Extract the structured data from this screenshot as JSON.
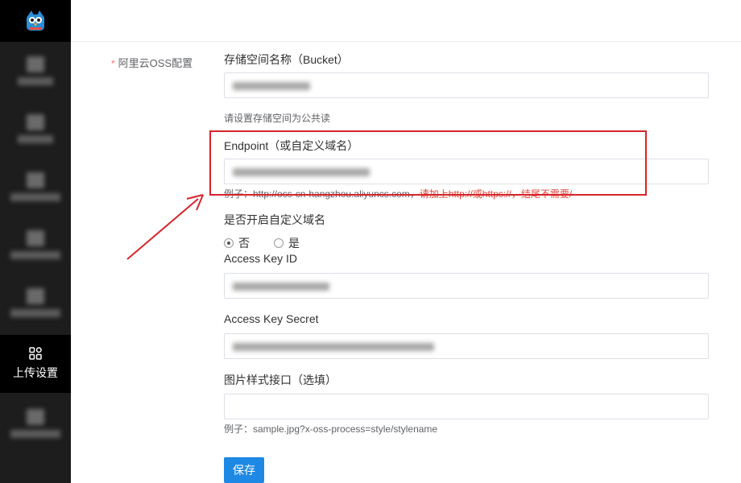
{
  "sidebar": {
    "logo_icon": "owl-logo-icon",
    "active_item": {
      "icon": "apps-grid-icon",
      "label": "上传设置"
    }
  },
  "form": {
    "section_label": "阿里云OSS配置",
    "required_mark": "*",
    "bucket": {
      "label": "存储空间名称（Bucket）",
      "hint": "请设置存储空间为公共读"
    },
    "endpoint": {
      "label": "Endpoint（或自定义域名）",
      "hint_example": "例子：http://oss-cn-hangzhou.aliyuncs.com，",
      "hint_warning": "请加上http://或https://，结尾不需要/"
    },
    "custom_domain": {
      "label": "是否开启自定义域名",
      "options": [
        "否",
        "是"
      ],
      "selected": "否"
    },
    "access_key_id": {
      "label": "Access Key ID"
    },
    "access_key_secret": {
      "label": "Access Key Secret"
    },
    "image_style": {
      "label": "图片样式接口（选填）",
      "value": "",
      "hint": "例子：sample.jpg?x-oss-process=style/stylename"
    },
    "save_label": "保存"
  },
  "colors": {
    "accent": "#1e88e5",
    "annotation": "#d8232a",
    "sidebar_bg": "#1d1d1d"
  }
}
